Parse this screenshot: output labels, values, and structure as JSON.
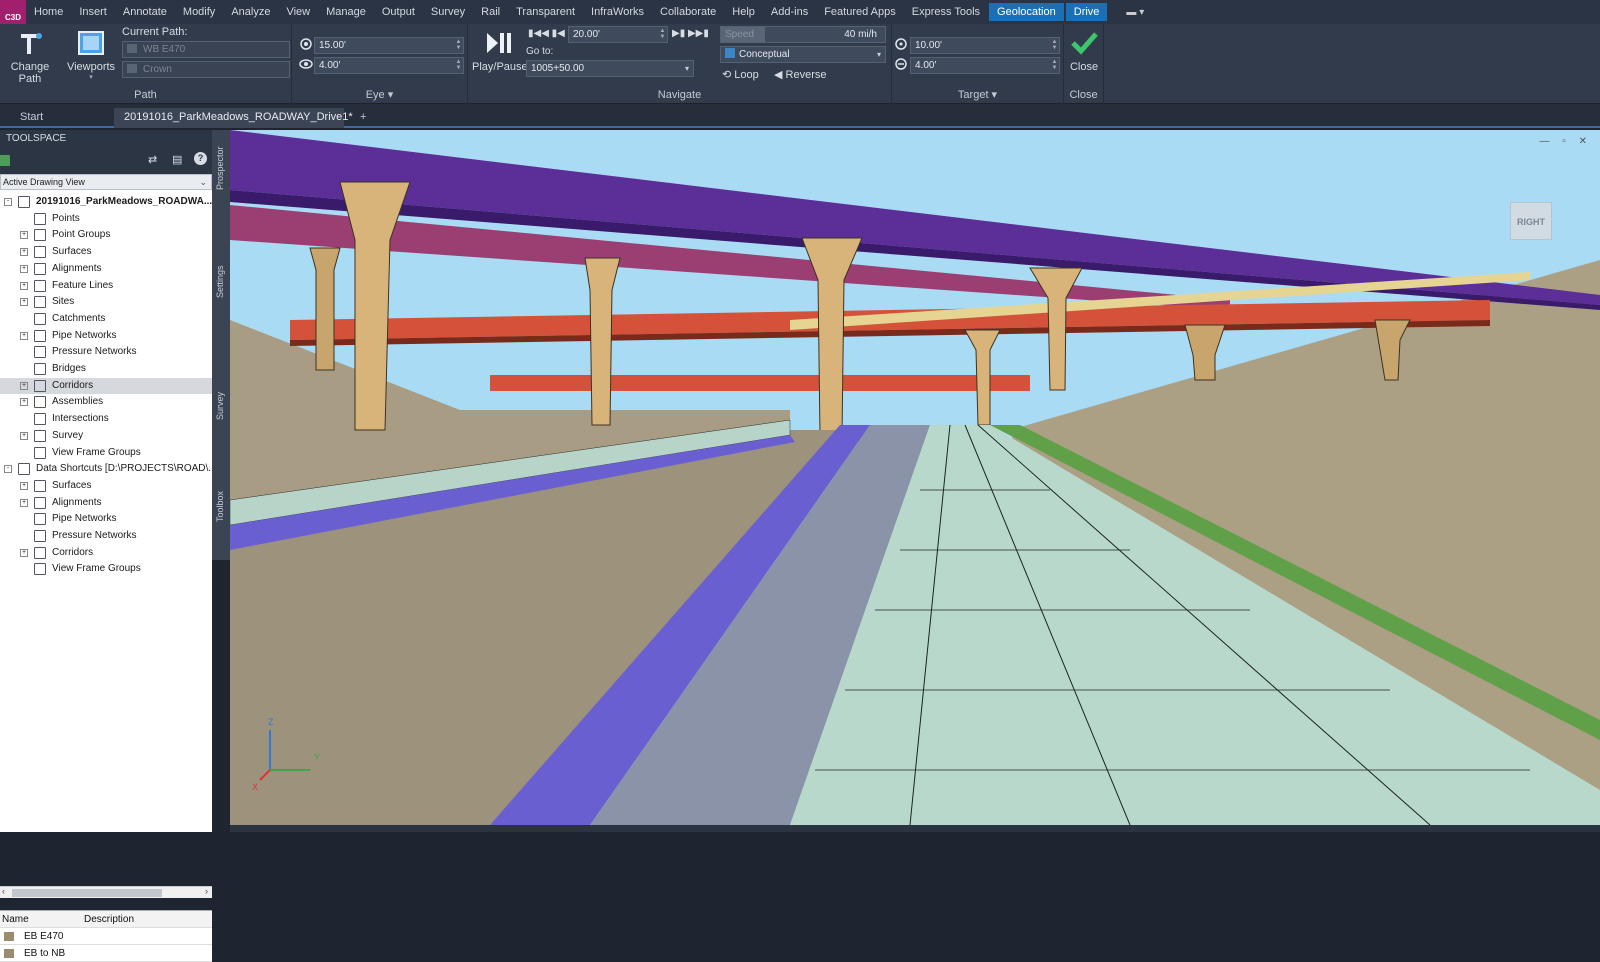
{
  "app": {
    "logo_text": "C3D"
  },
  "menu": [
    "Home",
    "Insert",
    "Annotate",
    "Modify",
    "Analyze",
    "View",
    "Manage",
    "Output",
    "Survey",
    "Rail",
    "Transparent",
    "InfraWorks",
    "Collaborate",
    "Help",
    "Add-ins",
    "Featured Apps",
    "Express Tools",
    "Geolocation",
    "Drive"
  ],
  "menu_active": [
    "Geolocation",
    "Drive"
  ],
  "ribbon": {
    "path_panel": {
      "title": "Path",
      "change_path_label": "Change Path",
      "viewports_label": "Viewports",
      "current_path_label": "Current Path:",
      "path_value": "WB E470",
      "profile_value": "Crown"
    },
    "eye_panel": {
      "title": "Eye",
      "height_value": "15.00'",
      "offset_value": "4.00'"
    },
    "navigate_panel": {
      "title": "Navigate",
      "play_pause_label": "Play/Pause",
      "step_value": "20.00'",
      "goto_label": "Go to:",
      "goto_value": "1005+50.00",
      "speed_label": "Speed",
      "speed_value": "40 mi/h",
      "visual_style_value": "Conceptual",
      "loop_label": "Loop",
      "reverse_label": "Reverse"
    },
    "target_panel": {
      "title": "Target",
      "distance_value": "10.00'",
      "offset_value": "4.00'"
    },
    "close_panel": {
      "title": "Close",
      "close_label": "Close"
    }
  },
  "tabs": {
    "start_label": "Start",
    "active_label": "20191016_ParkMeadows_ROADWAY_Drive1*",
    "add_label": "+"
  },
  "toolspace": {
    "title": "TOOLSPACE",
    "view_selector": "Active Drawing View",
    "side_tabs": [
      "Prospector",
      "Settings",
      "Survey",
      "Toolbox"
    ],
    "tree": [
      {
        "label": "20191016_ParkMeadows_ROADWA...",
        "level": 0,
        "bold": true,
        "exp": "-"
      },
      {
        "label": "Points",
        "level": 1,
        "exp": ""
      },
      {
        "label": "Point Groups",
        "level": 1,
        "exp": "+"
      },
      {
        "label": "Surfaces",
        "level": 1,
        "exp": "+"
      },
      {
        "label": "Alignments",
        "level": 1,
        "exp": "+"
      },
      {
        "label": "Feature Lines",
        "level": 1,
        "exp": "+"
      },
      {
        "label": "Sites",
        "level": 1,
        "exp": "+"
      },
      {
        "label": "Catchments",
        "level": 1,
        "exp": ""
      },
      {
        "label": "Pipe Networks",
        "level": 1,
        "exp": "+"
      },
      {
        "label": "Pressure Networks",
        "level": 1,
        "exp": ""
      },
      {
        "label": "Bridges",
        "level": 1,
        "exp": ""
      },
      {
        "label": "Corridors",
        "level": 1,
        "exp": "+",
        "selected": true
      },
      {
        "label": "Assemblies",
        "level": 1,
        "exp": "+"
      },
      {
        "label": "Intersections",
        "level": 1,
        "exp": ""
      },
      {
        "label": "Survey",
        "level": 1,
        "exp": "+"
      },
      {
        "label": "View Frame Groups",
        "level": 1,
        "exp": ""
      },
      {
        "label": "Data Shortcuts [D:\\PROJECTS\\ROAD\\...",
        "level": 0,
        "bold": false,
        "exp": "-"
      },
      {
        "label": "Surfaces",
        "level": 1,
        "exp": "+"
      },
      {
        "label": "Alignments",
        "level": 1,
        "exp": "+"
      },
      {
        "label": "Pipe Networks",
        "level": 1,
        "exp": ""
      },
      {
        "label": "Pressure Networks",
        "level": 1,
        "exp": ""
      },
      {
        "label": "Corridors",
        "level": 1,
        "exp": "+"
      },
      {
        "label": "View Frame Groups",
        "level": 1,
        "exp": ""
      }
    ],
    "grid_headers": [
      "Name",
      "Description"
    ],
    "grid_rows": [
      [
        "EB E470",
        ""
      ],
      [
        "EB to NB",
        ""
      ]
    ]
  },
  "viewport": {
    "view_cube_label": "RIGHT",
    "axis_x": "X",
    "axis_y": "Y",
    "axis_z": "Z"
  },
  "colors": {
    "sky": "#a9dcf4",
    "deck_purple": "#6a3ea6",
    "deck_red": "#d4523a",
    "pier_tan": "#d8b47a",
    "pavement": "#b9d8cc",
    "shoulder_blue": "#6a5fd0",
    "embankment": "#a89c84",
    "grass_green": "#5fa048",
    "accent": "#1a6fb5"
  }
}
